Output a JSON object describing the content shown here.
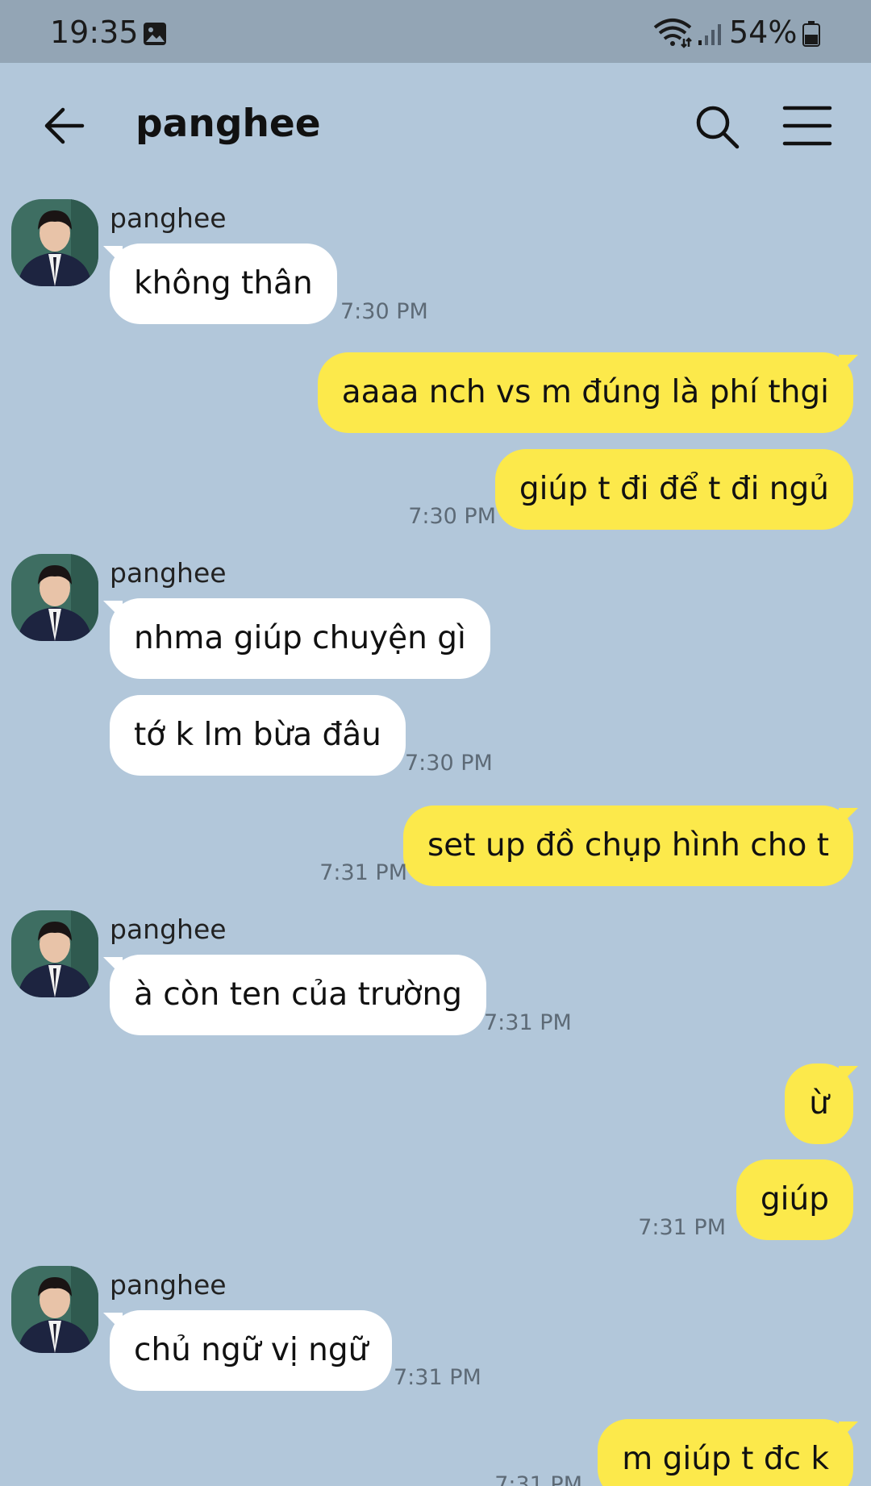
{
  "status_bar": {
    "time": "19:35",
    "battery": "54%"
  },
  "header": {
    "title": "panghee"
  },
  "sender_name": "panghee",
  "messages": [
    {
      "text": "không thân",
      "time": "7:30 PM"
    },
    {
      "text": "aaaa nch vs m đúng là phí thgi"
    },
    {
      "text": "giúp t đi để t đi ngủ",
      "time": "7:30 PM"
    },
    {
      "text": "nhma giúp chuyện gì"
    },
    {
      "text": "tớ k lm bừa đâu",
      "time": "7:30 PM"
    },
    {
      "text": "set up đồ chụp hình cho t",
      "time": "7:31 PM"
    },
    {
      "text": "à còn ten của trường",
      "time": "7:31 PM"
    },
    {
      "text": "ừ"
    },
    {
      "text": "giúp",
      "time": "7:31 PM"
    },
    {
      "text": "chủ ngữ vị ngữ",
      "time": "7:31 PM"
    },
    {
      "text": "m giúp t đc k",
      "time": "7:31 PM"
    }
  ],
  "colors": {
    "background": "#b2c7da",
    "status_bar": "#93a5b5",
    "incoming_bubble": "#ffffff",
    "outgoing_bubble": "#fce94b"
  }
}
